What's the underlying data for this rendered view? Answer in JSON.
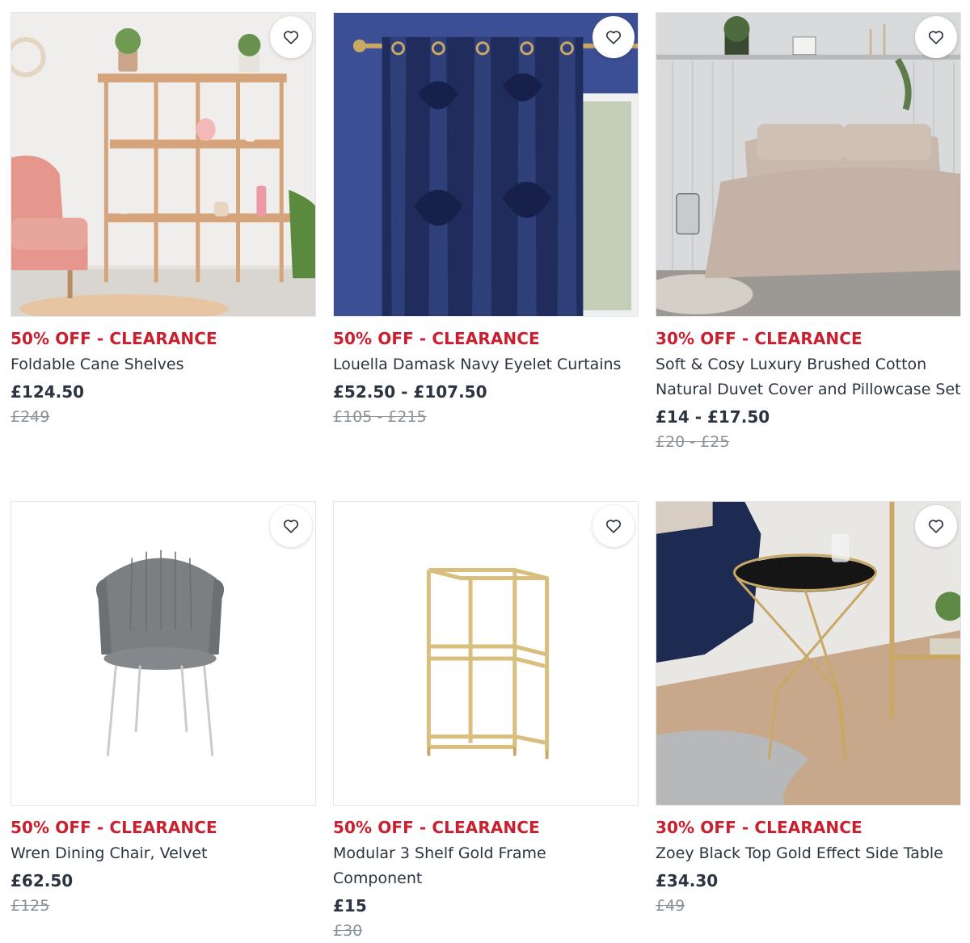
{
  "products": [
    {
      "badge": "50% OFF - CLEARANCE",
      "title": "Foldable Cane Shelves",
      "price": "£124.50",
      "was_price": "£249",
      "wishlist_icon": "heart-outline-icon"
    },
    {
      "badge": "50% OFF - CLEARANCE",
      "title": "Louella Damask Navy Eyelet Curtains",
      "price": "£52.50 - £107.50",
      "was_price": "£105 - £215",
      "wishlist_icon": "heart-outline-icon"
    },
    {
      "badge": "30% OFF - CLEARANCE",
      "title": "Soft & Cosy Luxury Brushed Cotton Natural Duvet Cover and Pillowcase Set",
      "price": "£14 - £17.50",
      "was_price": "£20 - £25",
      "wishlist_icon": "heart-outline-icon"
    },
    {
      "badge": "50% OFF - CLEARANCE",
      "title": "Wren Dining Chair, Velvet",
      "price": "£62.50",
      "was_price": "£125",
      "wishlist_icon": "heart-outline-icon"
    },
    {
      "badge": "50% OFF - CLEARANCE",
      "title": "Modular 3 Shelf Gold Frame Component",
      "price": "£15",
      "was_price": "£30",
      "wishlist_icon": "heart-outline-icon"
    },
    {
      "badge": "30% OFF - CLEARANCE",
      "title": "Zoey Black Top Gold Effect Side Table",
      "price": "£34.30",
      "was_price": "£49",
      "wishlist_icon": "heart-outline-icon"
    }
  ],
  "colors": {
    "badge": "#c8202f",
    "text": "#2b3440",
    "was_price": "#8a9097"
  }
}
